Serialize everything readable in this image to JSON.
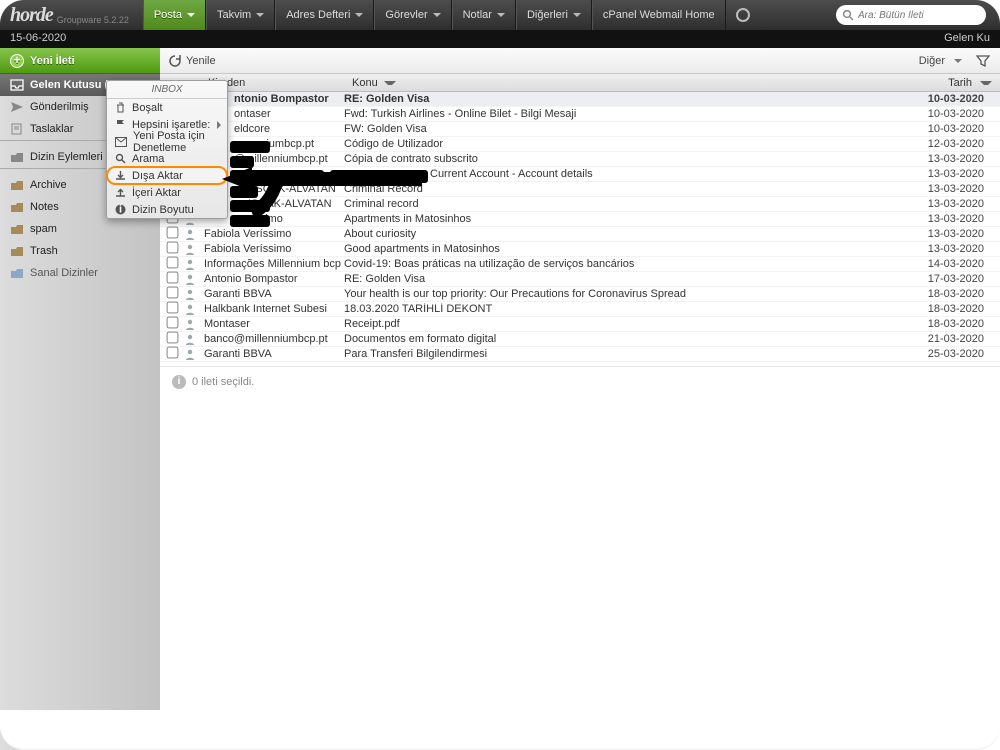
{
  "brand": {
    "name": "horde",
    "sub": "Groupware 5.2.22"
  },
  "nav": [
    {
      "label": "Posta",
      "active": true
    },
    {
      "label": "Takvim"
    },
    {
      "label": "Adres Defteri"
    },
    {
      "label": "Görevler"
    },
    {
      "label": "Notlar"
    },
    {
      "label": "Diğerleri"
    },
    {
      "label": "cPanel Webmail Home"
    }
  ],
  "search": {
    "placeholder": "Ara: Bütün İleti"
  },
  "dateLeft": "15-06-2020",
  "dateRight": "Gelen Ku",
  "newButton": "Yeni İleti",
  "sidebar": [
    {
      "label": "Gelen Kutusu (",
      "icon": "inbox",
      "bold": true
    },
    {
      "label": "Gönderilmiş",
      "icon": "sent"
    },
    {
      "label": "Taslaklar",
      "icon": "drafts"
    },
    {
      "spacer": true
    },
    {
      "label": "Dizin Eylemleri",
      "icon": "actions"
    },
    {
      "spacer": true
    },
    {
      "label": "Archive",
      "icon": "folder"
    },
    {
      "label": "Notes",
      "icon": "folder"
    },
    {
      "label": "spam",
      "icon": "folder"
    },
    {
      "label": "Trash",
      "icon": "folder"
    },
    {
      "label": "Sanal Dizinler",
      "icon": "vfolder",
      "muted": true
    }
  ],
  "toolbar": {
    "refresh": "Yenile",
    "other": "Diğer"
  },
  "columns": {
    "from": "Kimden",
    "subject": "Konu",
    "date": "Tarih"
  },
  "context": {
    "title": "INBOX",
    "items": [
      {
        "label": "Boşalt",
        "icon": "trash"
      },
      {
        "label": "Hepsini işaretle:",
        "icon": "flag",
        "sub": true
      },
      {
        "label": "Yeni Posta için Denetleme",
        "icon": "mail"
      },
      {
        "label": "Arama",
        "icon": "search"
      },
      {
        "label": "Dışa Aktar",
        "icon": "download",
        "hl": true
      },
      {
        "label": "İçeri Aktar",
        "icon": "upload"
      },
      {
        "label": "Dizin Boyutu",
        "icon": "info"
      }
    ]
  },
  "messages": [
    {
      "from": "ntonio Bompastor",
      "subject": "RE: Golden Visa",
      "date": "10-03-2020",
      "bold": true,
      "fromPad": 30
    },
    {
      "from": "ontaser",
      "subject": "Fwd: Turkish Airlines - Online Bilet - Bilgi Mesaji",
      "date": "10-03-2020",
      "fromPad": 30
    },
    {
      "from": "eldcore",
      "subject": "FW: Golden Visa",
      "date": "10-03-2020",
      "fromPad": 30
    },
    {
      "from": "enniumbcp.pt",
      "subject": "Código de Utilizador",
      "date": "12-03-2020",
      "fromPad": 44
    },
    {
      "from": "@millenniumbcp.pt",
      "subject": "Cópia de contrato subscrito",
      "date": "13-03-2020",
      "fromPad": 30
    },
    {
      "from": "",
      "subject": "Current Account - Account details",
      "date": "13-03-2020",
      "subjPad": 86
    },
    {
      "from": "var ISCAK-ALVATAN",
      "subject": "Criminal Record",
      "date": "13-03-2020",
      "fromPad": 30
    },
    {
      "from": "ISCAK-ALVATAN",
      "subject": "Criminal record",
      "date": "13-03-2020",
      "fromPad": 44
    },
    {
      "from": "essimo",
      "subject": "Apartments in Matosinhos",
      "date": "13-03-2020",
      "fromPad": 44
    },
    {
      "from": "Fabiola Veríssimo",
      "subject": "About curiosity",
      "date": "13-03-2020"
    },
    {
      "from": "Fabiola Veríssimo",
      "subject": "Good apartments in Matosinhos",
      "date": "13-03-2020"
    },
    {
      "from": "Informações Millennium bcp",
      "subject": "Covid-19: Boas práticas na utilização de serviços bancários",
      "date": "14-03-2020"
    },
    {
      "from": "Antonio Bompastor",
      "subject": "RE: Golden Visa",
      "date": "17-03-2020"
    },
    {
      "from": "Garanti BBVA",
      "subject": "Your health is our top priority: Our Precautions for Coronavirus Spread",
      "date": "18-03-2020"
    },
    {
      "from": "Halkbank Internet Subesi",
      "subject": "18.03.2020 TARİHLİ DEKONT",
      "date": "18-03-2020"
    },
    {
      "from": "Montaser",
      "subject": "Receipt.pdf",
      "date": "18-03-2020"
    },
    {
      "from": "banco@millenniumbcp.pt",
      "subject": "Documentos em formato digital",
      "date": "21-03-2020"
    },
    {
      "from": "Garanti BBVA",
      "subject": "Para Transferi Bilgilendirmesi",
      "date": "25-03-2020"
    }
  ],
  "status": "0 ileti seçildi."
}
